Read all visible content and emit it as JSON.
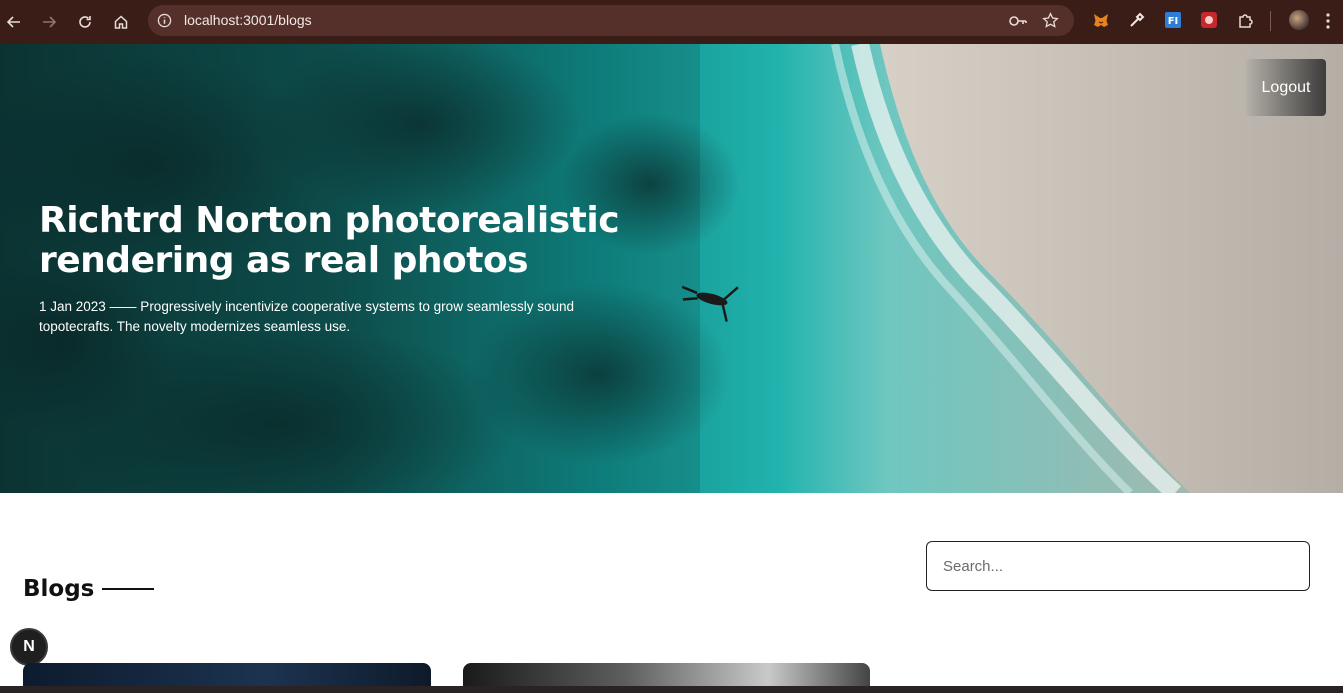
{
  "browser": {
    "url": "localhost:3001/blogs",
    "icons": {
      "back": "arrow-left-icon",
      "forward": "arrow-right-icon",
      "reload": "reload-icon",
      "home": "home-icon",
      "site_info": "info-icon",
      "password": "key-icon",
      "bookmark": "star-icon",
      "extensions": [
        "metamask-fox-icon",
        "eyedropper-icon",
        "fi-extension-icon",
        "red-extension-icon",
        "puzzle-icon"
      ],
      "profile": "avatar",
      "menu": "kebab-menu-icon"
    },
    "colors": {
      "toolbar": "#3a1d16",
      "omnibox": "#55302a"
    }
  },
  "hero": {
    "title": "Richtrd Norton photorealistic rendering as real photos",
    "meta": "1 Jan 2023 —— Progressively incentivize cooperative systems to grow seamlessly sound topotecrafts. The novelty modernizes seamless use.",
    "logout_label": "Logout"
  },
  "blogs": {
    "heading": "Blogs",
    "search_placeholder": "Search...",
    "fab_label": "N"
  }
}
